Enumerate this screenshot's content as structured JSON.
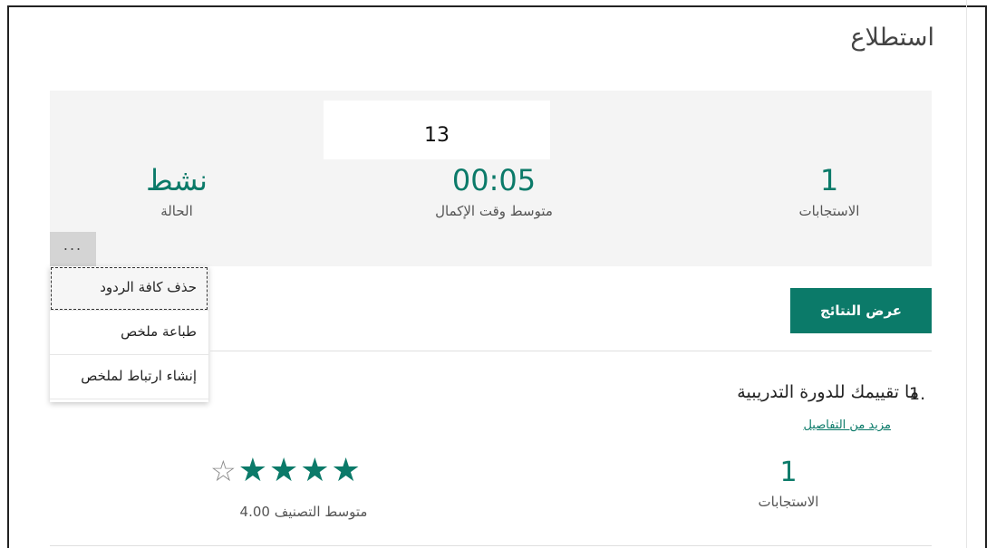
{
  "page": {
    "title": "استطلاع"
  },
  "summary": {
    "popup_value": "13",
    "responses_value": "1",
    "responses_label": "الاستجابات",
    "avg_time_value": "00:05",
    "avg_time_label": "متوسط وقت الإكمال",
    "status_value": "نشط",
    "status_label": "الحالة"
  },
  "more_button": {
    "label": "..."
  },
  "menu": {
    "items": [
      {
        "label": "حذف كافة الردود"
      },
      {
        "label": "طباعة ملخص"
      },
      {
        "label": "إنشاء ارتباط لملخص"
      }
    ]
  },
  "actions": {
    "view_results": "عرض النتائج"
  },
  "question": {
    "number": "1.",
    "text": "ما تقييمك للدورة التدريبية",
    "details_link": "مزيد من التفاصيل",
    "responses_value": "1",
    "responses_label": "الاستجابات",
    "rating_label": "متوسط التصنيف 4.00",
    "rating": {
      "value": 4.0,
      "max": 5
    }
  },
  "colors": {
    "accent": "#0b7a69"
  },
  "icons": {
    "filled_star": "star-filled-icon",
    "empty_star": "star-empty-icon",
    "more": "ellipsis-icon"
  }
}
